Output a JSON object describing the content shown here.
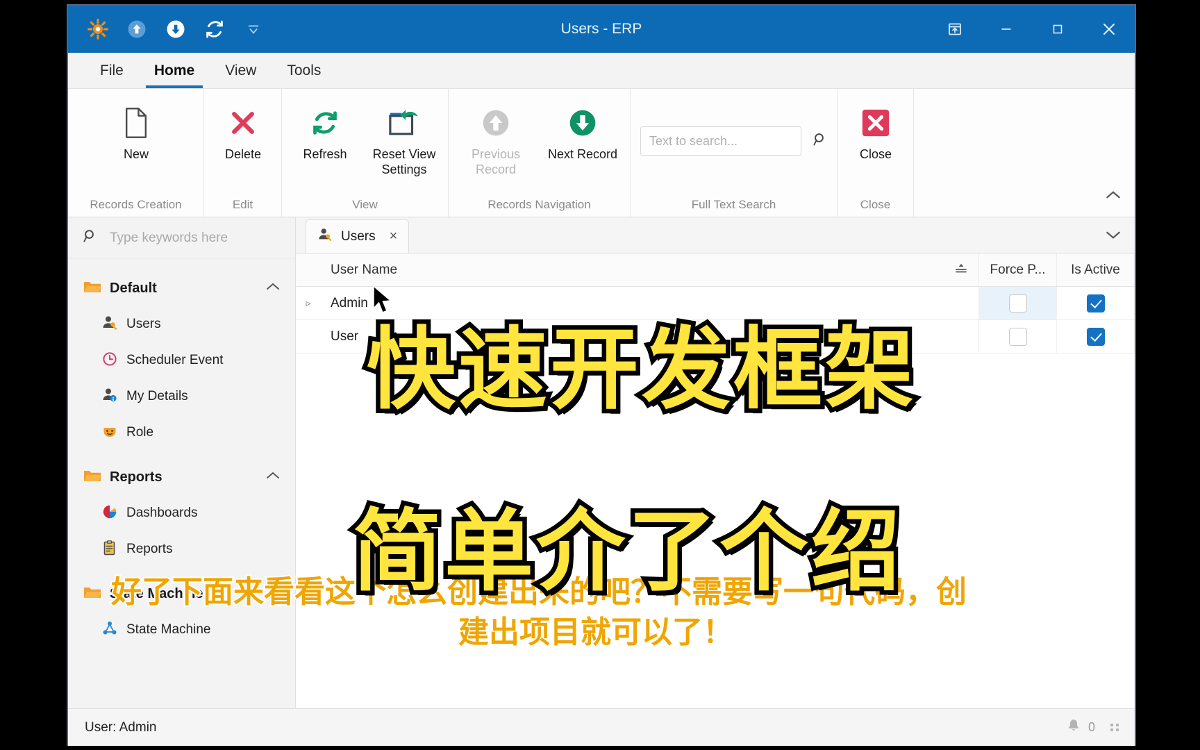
{
  "window": {
    "title": "Users - ERP",
    "quick_access": [
      {
        "name": "app-logo-icon",
        "label": "ERP"
      },
      {
        "name": "upload-icon",
        "label": "Upload"
      },
      {
        "name": "download-icon",
        "label": "Download"
      },
      {
        "name": "refresh-icon",
        "label": "Refresh"
      },
      {
        "name": "customize-quick-access-icon",
        "label": "Customize Quick Access Toolbar"
      }
    ],
    "controls": {
      "restore_down_label": "Restore Down",
      "minimize_label": "Minimize",
      "maximize_label": "Maximize",
      "close_label": "Close"
    },
    "accent_color": "#0d6bb5"
  },
  "ribbon": {
    "tabs": [
      {
        "label": "File",
        "active": false
      },
      {
        "label": "Home",
        "active": true
      },
      {
        "label": "View",
        "active": false
      },
      {
        "label": "Tools",
        "active": false
      }
    ],
    "collapse_label": "Collapse the Ribbon",
    "groups": [
      {
        "label": "Records Creation",
        "buttons": [
          {
            "label": "New",
            "icon": "new-document-icon",
            "disabled": false
          }
        ]
      },
      {
        "label": "Edit",
        "buttons": [
          {
            "label": "Delete",
            "icon": "delete-x-icon",
            "disabled": false
          }
        ]
      },
      {
        "label": "View",
        "buttons": [
          {
            "label": "Refresh",
            "icon": "refresh-circular-icon",
            "disabled": false
          },
          {
            "label": "Reset View Settings",
            "icon": "reset-view-icon",
            "disabled": false
          }
        ]
      },
      {
        "label": "Records Navigation",
        "buttons": [
          {
            "label": "Previous Record",
            "icon": "arrow-up-circle-icon",
            "disabled": true
          },
          {
            "label": "Next Record",
            "icon": "arrow-down-circle-icon",
            "disabled": false
          }
        ]
      },
      {
        "label": "Full Text Search",
        "search": {
          "value": "",
          "placeholder": "Text to search...",
          "icon": "search-icon"
        }
      },
      {
        "label": "Close",
        "buttons": [
          {
            "label": "Close",
            "icon": "close-red-icon",
            "disabled": false
          }
        ]
      }
    ]
  },
  "sidebar": {
    "search": {
      "value": "",
      "placeholder": "Type keywords here",
      "icon": "search-icon"
    },
    "groups": [
      {
        "label": "Default",
        "expanded": true,
        "items": [
          {
            "label": "Users",
            "icon": "user-key-icon"
          },
          {
            "label": "Scheduler Event",
            "icon": "clock-icon"
          },
          {
            "label": "My Details",
            "icon": "user-info-icon"
          },
          {
            "label": "Role",
            "icon": "mask-icon"
          }
        ]
      },
      {
        "label": "Reports",
        "expanded": true,
        "items": [
          {
            "label": "Dashboards",
            "icon": "pie-chart-icon"
          },
          {
            "label": "Reports",
            "icon": "clipboard-icon"
          }
        ]
      },
      {
        "label": "State Machine",
        "expanded": true,
        "items": [
          {
            "label": "State Machine",
            "icon": "state-machine-icon"
          }
        ]
      }
    ]
  },
  "content": {
    "tabs": [
      {
        "label": "Users",
        "icon": "user-key-icon",
        "active": true,
        "close_label": "×"
      }
    ],
    "tabstrip_chevron_label": "Show tab list",
    "grid": {
      "columns": [
        {
          "key": "username",
          "label": "User Name",
          "sort_glyph": "≡"
        },
        {
          "key": "force_password",
          "label": "Force P..."
        },
        {
          "key": "is_active",
          "label": "Is Active"
        }
      ],
      "rows": [
        {
          "expander": "▹",
          "username": "Admin",
          "force_password": false,
          "is_active": true,
          "selected": true
        },
        {
          "expander": "",
          "username": "User",
          "force_password": false,
          "is_active": true,
          "selected": false
        }
      ]
    }
  },
  "statusbar": {
    "user_text": "User: Admin",
    "notification_icon": "bell-icon",
    "notification_count": "0",
    "resize_grip": "resize-grip-icon"
  },
  "overlays": {
    "title_line1": "快速开发框架",
    "title_line2": "简单介了个绍",
    "subtitle_line1": "好了下面来看看这个怎么创建出来的吧？不需要写一句代码，创",
    "subtitle_line2": "建出项目就可以了！",
    "title_color": "#ffe53d",
    "subtitle_color": "#f0a500"
  }
}
